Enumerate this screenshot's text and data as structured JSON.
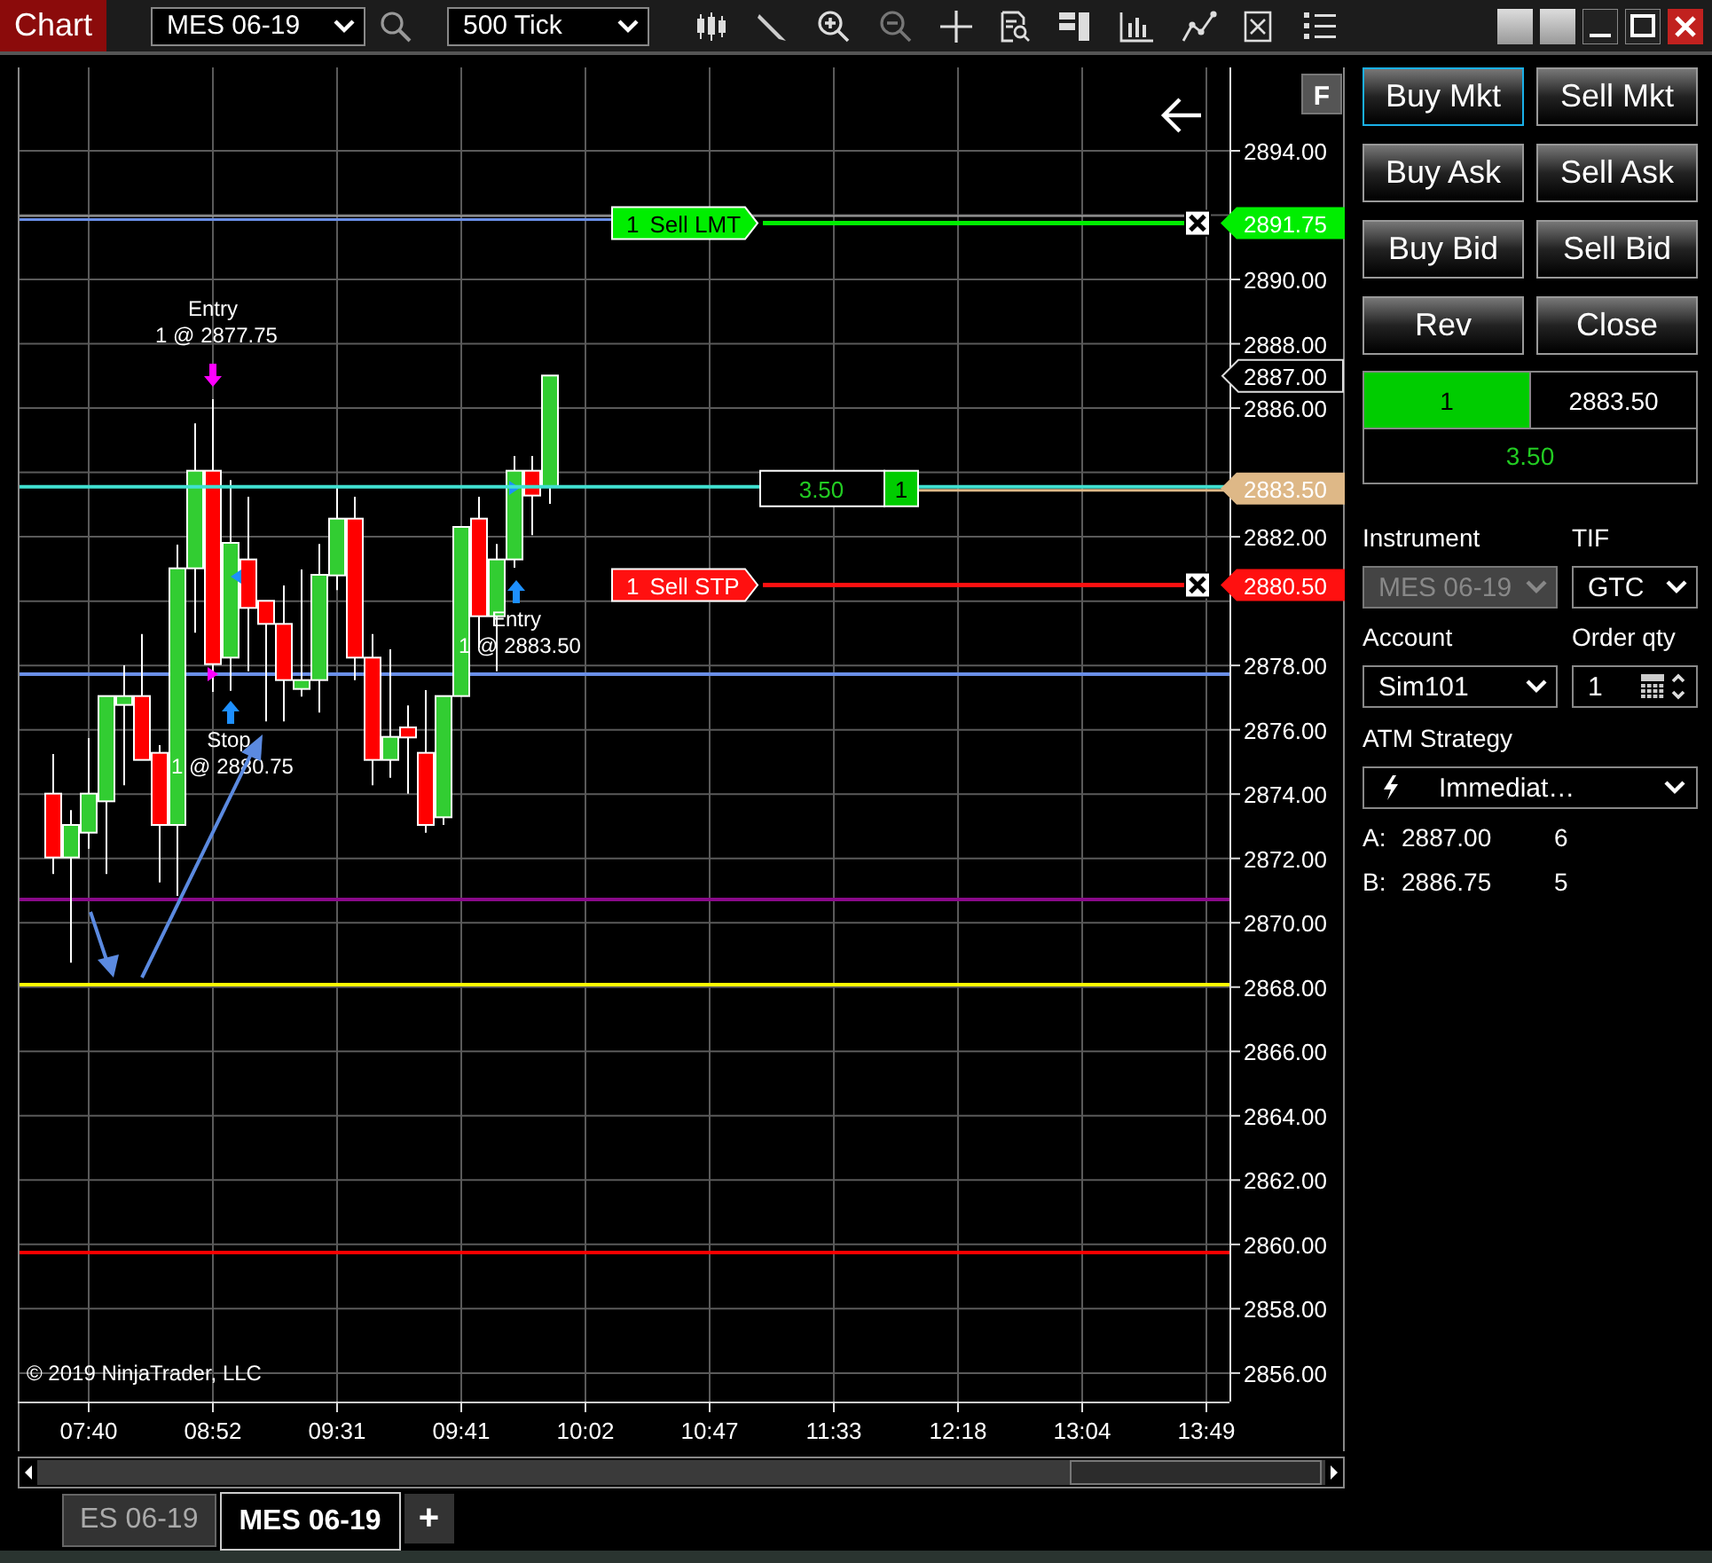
{
  "toolbar": {
    "title": "Chart",
    "instrument": "MES 06-19",
    "interval": "500 Tick"
  },
  "chart": {
    "scale_button": "F",
    "price_ticks": [
      "2894.00",
      "2890.00",
      "2888.00",
      "2886.00",
      "2882.00",
      "2878.00",
      "2876.00",
      "2874.00",
      "2872.00",
      "2870.00",
      "2868.00",
      "2866.00",
      "2864.00",
      "2862.00",
      "2860.00",
      "2858.00",
      "2856.00"
    ],
    "time_ticks": [
      "07:40",
      "08:52",
      "09:31",
      "09:41",
      "10:02",
      "10:47",
      "11:33",
      "12:18",
      "13:04",
      "13:49"
    ],
    "orders": [
      {
        "quantity": "1",
        "label": "Sell LMT",
        "price": "2891.75",
        "kind": "limit"
      },
      {
        "quantity": "1",
        "label": "Sell STP",
        "price": "2880.50",
        "kind": "stop"
      }
    ],
    "position": {
      "pnl": "3.50",
      "quantity": "1",
      "price": "2883.50"
    },
    "last_price": "2887.00",
    "executions": [
      {
        "kind": "sell",
        "label": "Entry",
        "detail": "1 @ 2877.75"
      },
      {
        "kind": "buy",
        "label": "Stop",
        "detail": "1 @ 2880.75"
      },
      {
        "kind": "buy",
        "label": "Entry",
        "detail": "1 @ 2883.50"
      }
    ],
    "copyright": "© 2019 NinjaTrader, LLC"
  },
  "order_entry": {
    "buttons": [
      {
        "label": "Buy Mkt",
        "focused": true
      },
      {
        "label": "Sell Mkt",
        "focused": false
      },
      {
        "label": "Buy Ask",
        "focused": false
      },
      {
        "label": "Sell Ask",
        "focused": false
      },
      {
        "label": "Buy Bid",
        "focused": false
      },
      {
        "label": "Sell Bid",
        "focused": false
      },
      {
        "label": "Rev",
        "focused": false
      },
      {
        "label": "Close",
        "focused": false
      }
    ],
    "position": {
      "quantity": "1",
      "average_price": "2883.50",
      "pnl": "3.50"
    },
    "fields": [
      {
        "label": "Instrument",
        "value": "MES 06-19",
        "kind": "dropdown",
        "disabled": true
      },
      {
        "label": "TIF",
        "value": "GTC",
        "kind": "dropdown",
        "disabled": false
      },
      {
        "label": "Account",
        "value": "Sim101",
        "kind": "dropdown",
        "disabled": false
      },
      {
        "label": "Order qty",
        "value": "1",
        "kind": "spinner",
        "disabled": false
      }
    ],
    "atm_strategy": {
      "label": "ATM Strategy",
      "value": "Immediat…"
    },
    "quotes": [
      {
        "side": "A:",
        "price": "2887.00",
        "size": "6"
      },
      {
        "side": "B:",
        "price": "2886.75",
        "size": "5"
      }
    ]
  },
  "tabs": [
    {
      "label": "ES 06-19",
      "selected": false
    },
    {
      "label": "MES 06-19",
      "selected": true
    }
  ],
  "add_tab": "+"
}
